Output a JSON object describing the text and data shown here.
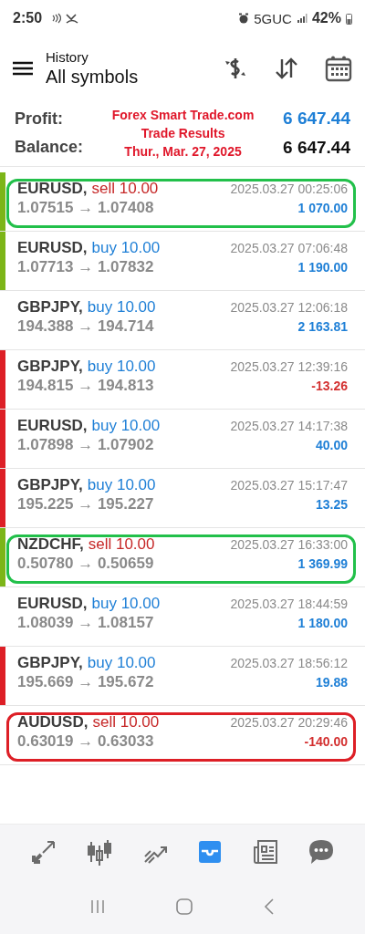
{
  "status_bar": {
    "time": "2:50",
    "network": "5GUC",
    "battery": "42%"
  },
  "header": {
    "title": "History",
    "subtitle": "All symbols"
  },
  "summary": [
    {
      "label": "Profit:",
      "value": "6 647.44",
      "kind": "profit"
    },
    {
      "label": "Balance:",
      "value": "6 647.44",
      "kind": "balance"
    }
  ],
  "annotation": [
    "Forex Smart Trade.com",
    "Trade Results",
    "Thur., Mar. 27, 2025"
  ],
  "trades": [
    {
      "symbol": "EURUSD,",
      "side": "sell",
      "volume": "10.00",
      "prices": "1.07515 → 1.07408",
      "time": "2025.03.27 00:25:06",
      "profit": "1 070.00",
      "negative": false,
      "color": "#7cb518",
      "highlight": {
        "color": "#22c04a"
      }
    },
    {
      "symbol": "EURUSD,",
      "side": "buy",
      "volume": "10.00",
      "prices": "1.07713 → 1.07832",
      "time": "2025.03.27 07:06:48",
      "profit": "1 190.00",
      "negative": false,
      "color": "#7cb518"
    },
    {
      "symbol": "GBPJPY,",
      "side": "buy",
      "volume": "10.00",
      "prices": "194.388 → 194.714",
      "time": "2025.03.27 12:06:18",
      "profit": "2 163.81",
      "negative": false
    },
    {
      "symbol": "GBPJPY,",
      "side": "buy",
      "volume": "10.00",
      "prices": "194.815 → 194.813",
      "time": "2025.03.27 12:39:16",
      "profit": "-13.26",
      "negative": true,
      "color": "#dd1f26"
    },
    {
      "symbol": "EURUSD,",
      "side": "buy",
      "volume": "10.00",
      "prices": "1.07898 → 1.07902",
      "time": "2025.03.27 14:17:38",
      "profit": "40.00",
      "negative": false,
      "color": "#dd1f26"
    },
    {
      "symbol": "GBPJPY,",
      "side": "buy",
      "volume": "10.00",
      "prices": "195.225 → 195.227",
      "time": "2025.03.27 15:17:47",
      "profit": "13.25",
      "negative": false,
      "color": "#dd1f26"
    },
    {
      "symbol": "NZDCHF,",
      "side": "sell",
      "volume": "10.00",
      "prices": "0.50780 → 0.50659",
      "time": "2025.03.27 16:33:00",
      "profit": "1 369.99",
      "negative": false,
      "color": "#7cb518",
      "highlight": {
        "color": "#22c04a"
      }
    },
    {
      "symbol": "EURUSD,",
      "side": "buy",
      "volume": "10.00",
      "prices": "1.08039 → 1.08157",
      "time": "2025.03.27 18:44:59",
      "profit": "1 180.00",
      "negative": false
    },
    {
      "symbol": "GBPJPY,",
      "side": "buy",
      "volume": "10.00",
      "prices": "195.669 → 195.672",
      "time": "2025.03.27 18:56:12",
      "profit": "19.88",
      "negative": false,
      "color": "#dd1f26"
    },
    {
      "symbol": "AUDUSD,",
      "side": "sell",
      "volume": "10.00",
      "prices": "0.63019 → 0.63033",
      "time": "2025.03.27 20:29:46",
      "profit": "-140.00",
      "negative": true,
      "highlight": {
        "color": "#dd1f26"
      }
    }
  ],
  "bottom_nav": [
    {
      "kind": "quotes",
      "selected": false
    },
    {
      "kind": "chart",
      "selected": false
    },
    {
      "kind": "trade",
      "selected": false
    },
    {
      "kind": "history",
      "selected": true
    },
    {
      "kind": "news",
      "selected": false
    },
    {
      "kind": "chat",
      "selected": false
    }
  ]
}
